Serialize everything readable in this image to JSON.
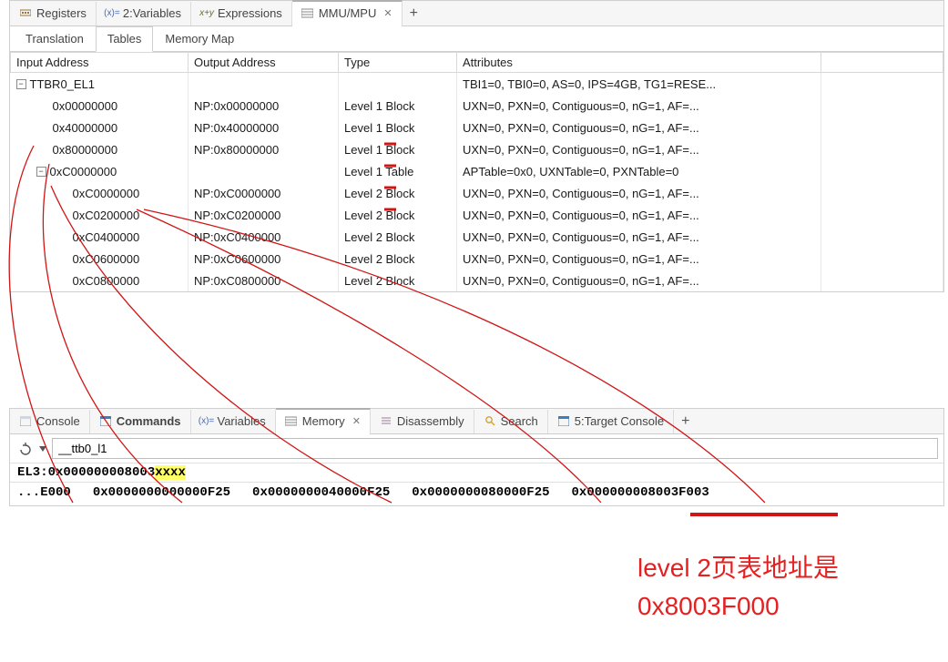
{
  "top_tabs": [
    {
      "label": "Registers",
      "icon": "registers-icon"
    },
    {
      "label": "2:Variables",
      "icon": "variables-icon"
    },
    {
      "label": "Expressions",
      "icon": "expressions-icon"
    },
    {
      "label": "MMU/MPU",
      "icon": "mmu-icon",
      "active": true,
      "closable": true
    }
  ],
  "sub_tabs": [
    {
      "label": "Translation"
    },
    {
      "label": "Tables",
      "active": true
    },
    {
      "label": "Memory Map"
    }
  ],
  "table": {
    "headers": {
      "c0": "Input Address",
      "c1": "Output Address",
      "c2": "Type",
      "c3": "Attributes"
    },
    "rows": [
      {
        "depth": 0,
        "exp": "minus",
        "input": "TTBR0_EL1",
        "output": "",
        "type": "",
        "attr": "TBI1=0, TBI0=0, AS=0, IPS=4GB, TG1=RESE..."
      },
      {
        "depth": 1,
        "exp": "",
        "input": "0x00000000",
        "output": "NP:0x00000000",
        "type": "Level 1 Block",
        "attr": "UXN=0, PXN=0, Contiguous=0, nG=1, AF=..."
      },
      {
        "depth": 1,
        "exp": "",
        "input": "0x40000000",
        "output": "NP:0x40000000",
        "type": "Level 1 Block",
        "attr": "UXN=0, PXN=0, Contiguous=0, nG=1, AF=..."
      },
      {
        "depth": 1,
        "exp": "",
        "input": "0x80000000",
        "output": "NP:0x80000000",
        "type": "Level 1 Block",
        "attr": "UXN=0, PXN=0, Contiguous=0, nG=1, AF=..."
      },
      {
        "depth": 1,
        "exp": "minus",
        "input": "0xC0000000",
        "output": "",
        "type": "Level 1 Table",
        "attr": "APTable=0x0, UXNTable=0, PXNTable=0"
      },
      {
        "depth": 2,
        "exp": "",
        "input": "0xC0000000",
        "output": "NP:0xC0000000",
        "type": "Level 2 Block",
        "attr": "UXN=0, PXN=0, Contiguous=0, nG=1, AF=..."
      },
      {
        "depth": 2,
        "exp": "",
        "input": "0xC0200000",
        "output": "NP:0xC0200000",
        "type": "Level 2 Block",
        "attr": "UXN=0, PXN=0, Contiguous=0, nG=1, AF=..."
      },
      {
        "depth": 2,
        "exp": "",
        "input": "0xC0400000",
        "output": "NP:0xC0400000",
        "type": "Level 2 Block",
        "attr": "UXN=0, PXN=0, Contiguous=0, nG=1, AF=..."
      },
      {
        "depth": 2,
        "exp": "",
        "input": "0xC0600000",
        "output": "NP:0xC0600000",
        "type": "Level 2 Block",
        "attr": "UXN=0, PXN=0, Contiguous=0, nG=1, AF=..."
      },
      {
        "depth": 2,
        "exp": "",
        "input": "0xC0800000",
        "output": "NP:0xC0800000",
        "type": "Level 2 Block",
        "attr": "UXN=0, PXN=0, Contiguous=0, nG=1, AF=..."
      }
    ]
  },
  "bottom_tabs": [
    {
      "label": "Console",
      "icon": "console-icon"
    },
    {
      "label": "Commands",
      "icon": "commands-icon",
      "bold": true
    },
    {
      "label": "Variables",
      "icon": "variables-icon"
    },
    {
      "label": "Memory",
      "icon": "memory-icon",
      "active": true,
      "closable": true
    },
    {
      "label": "Disassembly",
      "icon": "disassembly-icon"
    },
    {
      "label": "Search",
      "icon": "search-icon"
    },
    {
      "label": "5:Target Console",
      "icon": "target-console-icon"
    }
  ],
  "memory": {
    "input_value": "__ttb0_l1",
    "address_prefix": "EL3:0x000000008003",
    "address_highlight": "xxxx",
    "row_prefix": "...E000",
    "words": [
      "0x0000000000000F25",
      "0x0000000040000F25",
      "0x0000000080000F25",
      "0x000000008003F003"
    ]
  },
  "annotations": {
    "line1": "level 2页表地址是",
    "line2": "0x8003F000"
  }
}
